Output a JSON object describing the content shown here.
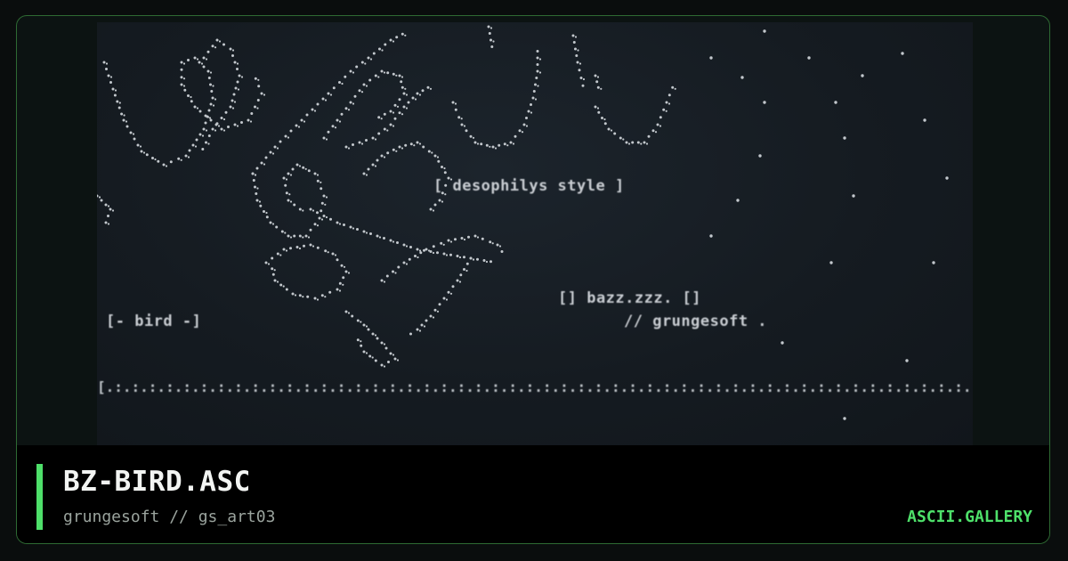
{
  "card": {
    "title": "BZ-BIRD.ASC",
    "subtitle": "grungesoft // gs_art03",
    "site": "ASCII.GALLERY"
  },
  "art": {
    "tag_style": "[ desophilys style ]",
    "tag_bird": "[- bird -]",
    "tag_bazz": "[] bazz.zzz. []",
    "tag_grunge": "// grungesoft .",
    "border_line": "[.:.:.:.:.:.:.:.:.:.:.:.:.:.:.:.:.:.:.:.:.:.:.:.:.:.:.:.:.:.:.:.:.:.:.:.:.:.:.:.:.:.:.:.:.:.:.:.:.:.:.:.:.:.:.:.:.:.:.:.:.:.:.:.:.:.:.:.:.:.:.:.]"
  },
  "colors": {
    "accent": "#4ee06a",
    "frame_border": "#2e6a33",
    "art_background": "#161c22",
    "art_ink": "#c9cdd2"
  }
}
